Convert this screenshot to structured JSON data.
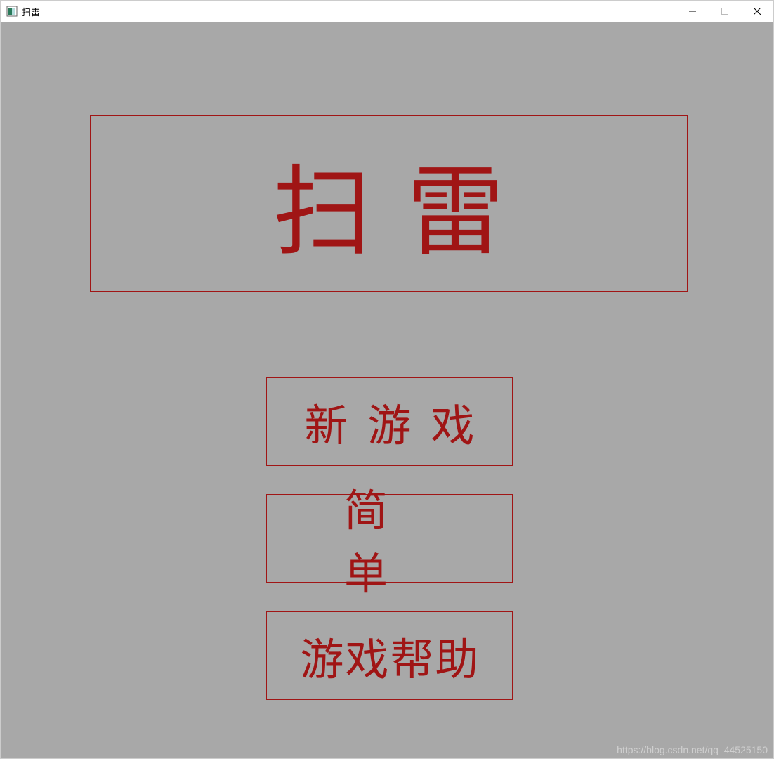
{
  "window": {
    "title": "扫雷"
  },
  "main": {
    "heading": "扫雷"
  },
  "menu": {
    "new_game": "新游戏",
    "difficulty": "简单",
    "help": "游戏帮助"
  },
  "watermark": "https://blog.csdn.net/qq_44525150"
}
